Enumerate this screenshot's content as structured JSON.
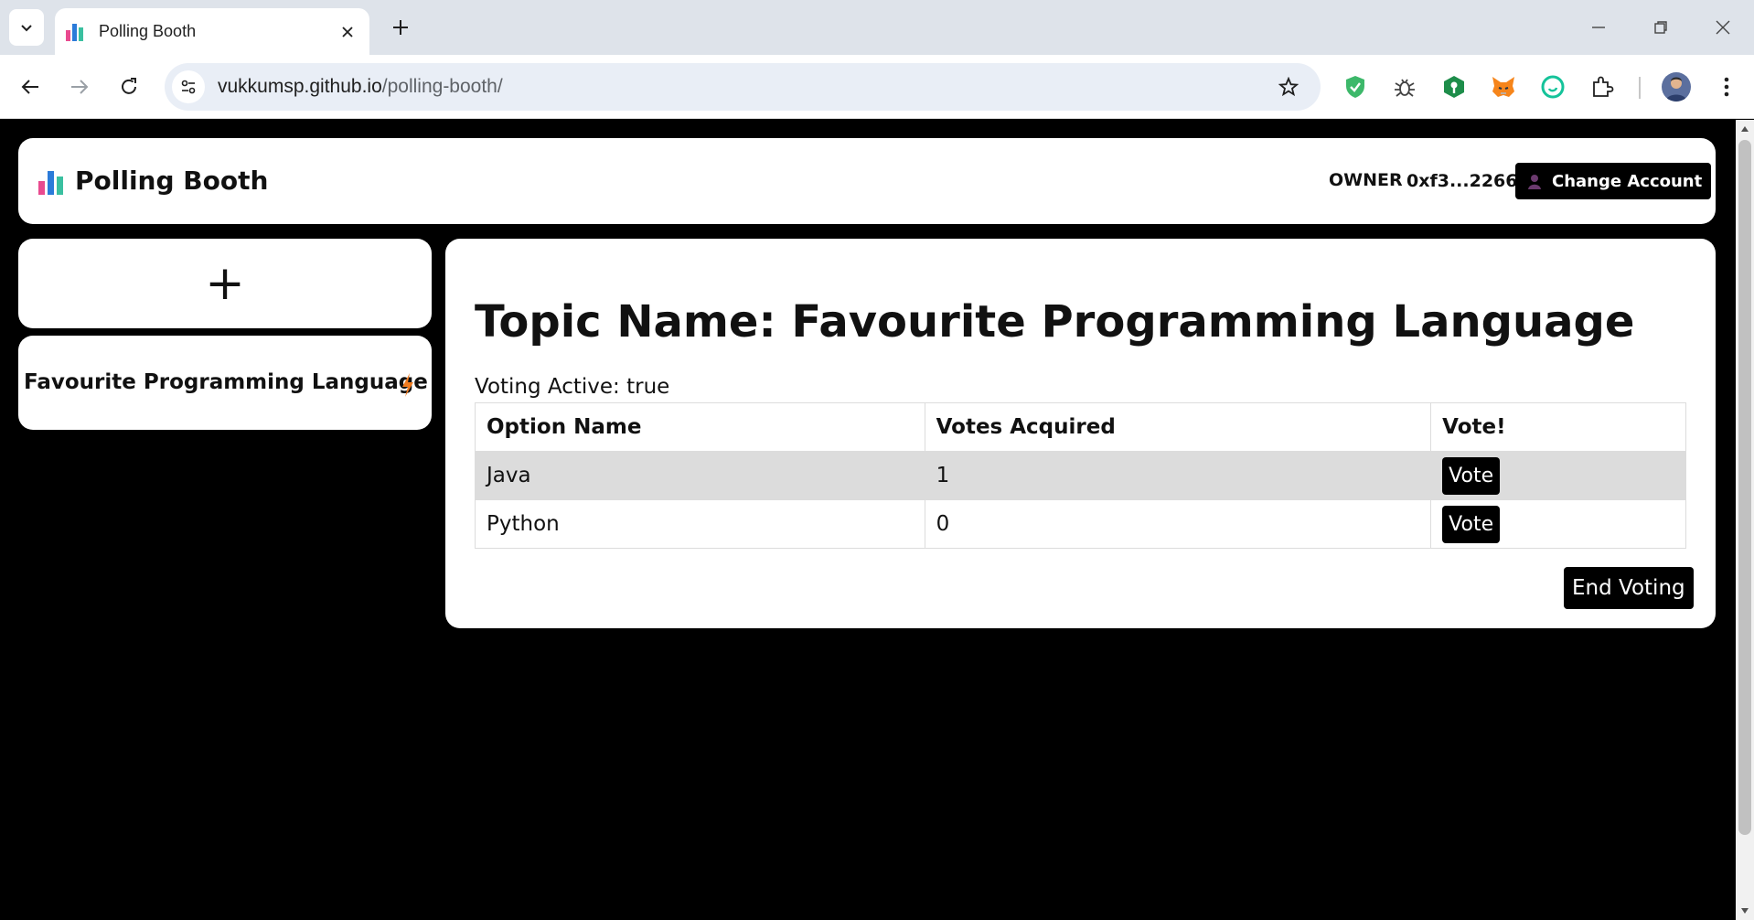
{
  "browser": {
    "tab_title": "Polling Booth",
    "url_host": "vukkumsp.github.io",
    "url_path": "/polling-booth/"
  },
  "header": {
    "brand": "Polling Booth",
    "role": "OWNER",
    "account": "0xf3...2266",
    "change_account": "Change Account"
  },
  "sidebar": {
    "add_label": "+",
    "topics": [
      {
        "name": "Favourite Programming Language"
      }
    ]
  },
  "main": {
    "title": "Topic Name: Favourite Programming Language",
    "status": "Voting Active: true",
    "table": {
      "headers": [
        "Option Name",
        "Votes Acquired",
        "Vote!"
      ],
      "rows": [
        {
          "option": "Java",
          "votes": "1",
          "action": "Vote"
        },
        {
          "option": "Python",
          "votes": "0",
          "action": "Vote"
        }
      ]
    },
    "end_voting": "End Voting"
  },
  "colors": {
    "page_bg": "#000000",
    "card_bg": "#ffffff",
    "row_highlight": "#dcdcdc",
    "bolt": "#f07b20"
  }
}
